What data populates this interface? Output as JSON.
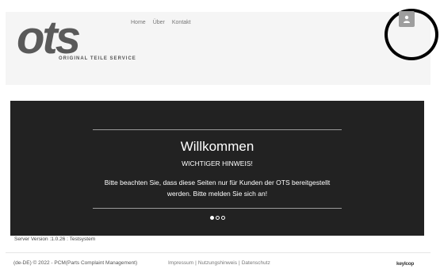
{
  "header": {
    "logo_text": "ots",
    "logo_subtitle": "ORIGINAL TEILE SERVICE",
    "nav": [
      {
        "label": "Home"
      },
      {
        "label": "Über"
      },
      {
        "label": "Kontakt"
      }
    ],
    "user_icon": "user-icon"
  },
  "banner": {
    "title": "Willkommen",
    "subtitle": "WICHTIGER HINWEIS!",
    "text": "Bitte beachten Sie, dass diese Seiten nur für Kunden der OTS bereitgestellt werden. Bitte melden Sie sich an!",
    "slides": 3,
    "active_slide": 1
  },
  "server_version": "Server Version :1.0.26 : Testsystem",
  "footer": {
    "copyright": "(de-DE) © 2022 - PCM(Parts Complaint Management)",
    "links": [
      {
        "label": "Impressum"
      },
      {
        "label": "Nutzungshinweis"
      },
      {
        "label": "Datenschutz"
      }
    ],
    "brand": "keylcop"
  },
  "colors": {
    "header_bg": "#f5f5f5",
    "banner_bg": "#222222",
    "logo_gray": "#5a5a5a",
    "user_button": "#9e9e9e"
  }
}
